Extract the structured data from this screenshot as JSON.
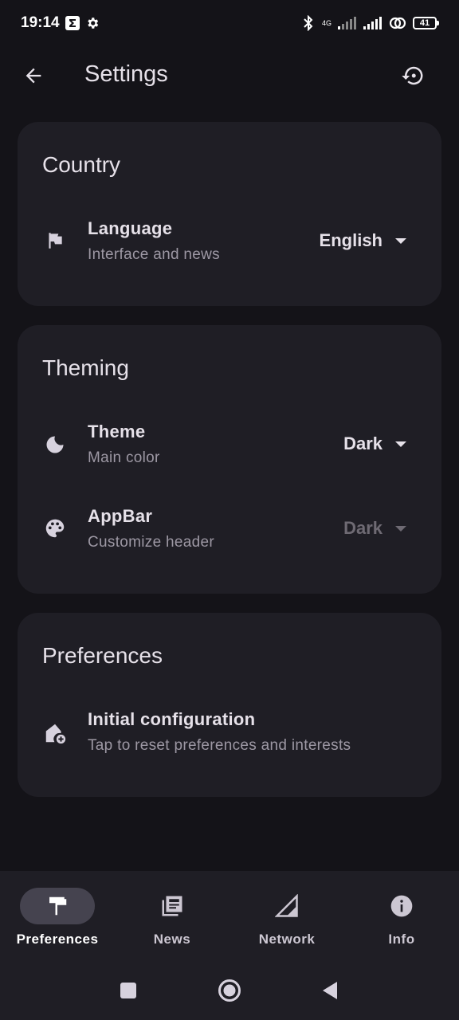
{
  "status_bar": {
    "time": "19:14",
    "network_type": "4G",
    "battery_level": "41"
  },
  "app_bar": {
    "title": "Settings"
  },
  "sections": [
    {
      "title": "Country",
      "rows": [
        {
          "title": "Language",
          "subtitle": "Interface and news",
          "value": "English",
          "icon": "flag-icon",
          "enabled": true
        }
      ]
    },
    {
      "title": "Theming",
      "rows": [
        {
          "title": "Theme",
          "subtitle": "Main color",
          "value": "Dark",
          "icon": "moon-icon",
          "enabled": true
        },
        {
          "title": "AppBar",
          "subtitle": "Customize header",
          "value": "Dark",
          "icon": "palette-icon",
          "enabled": false
        }
      ]
    },
    {
      "title": "Preferences",
      "rows": [
        {
          "title": "Initial configuration",
          "subtitle": "Tap to reset preferences and interests",
          "icon": "home-add-icon"
        }
      ]
    }
  ],
  "bottom_nav": {
    "active_index": 0,
    "items": [
      {
        "label": "Preferences",
        "icon": "paint-roller-icon"
      },
      {
        "label": "News",
        "icon": "newspaper-icon"
      },
      {
        "label": "Network",
        "icon": "signal-icon"
      },
      {
        "label": "Info",
        "icon": "info-icon"
      }
    ]
  },
  "colors": {
    "background": "#141318",
    "card": "#1f1e25",
    "text_primary": "#e6e1e9",
    "text_secondary": "#9d98a4",
    "active_pill": "#45434f"
  }
}
